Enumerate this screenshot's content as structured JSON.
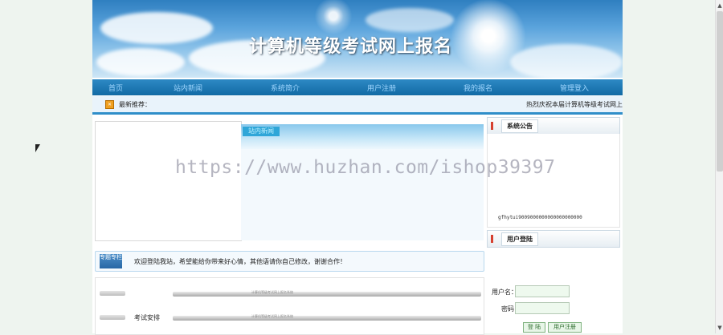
{
  "banner": {
    "title": "计算机等级考试网上报名"
  },
  "nav": {
    "items": [
      {
        "label": "首页"
      },
      {
        "label": "站内新闻"
      },
      {
        "label": "系统简介"
      },
      {
        "label": "用户注册"
      },
      {
        "label": "我的报名"
      },
      {
        "label": "管理登入"
      }
    ]
  },
  "ticker": {
    "label": "最新推荐：",
    "text": "热烈庆祝本届计算机等级考试网上报名系统上线"
  },
  "news": {
    "tab_label": "站内新闻"
  },
  "notice": {
    "title": "系统公告",
    "text": "gfhytui9009000000000000000000"
  },
  "login_box": {
    "title": "用户登陆"
  },
  "welcome": {
    "icon_text": "专题专栏",
    "text": "欢迎登陆我站，希望能给你带来好心情，其他语请你自己修改，谢谢合作！"
  },
  "lower_list": {
    "rows": [
      {
        "label": "",
        "bar_text": "计算机等级考试网上报名系统"
      },
      {
        "label": "考试安排",
        "bar_text": "计算机等级考试网上报名系统"
      }
    ]
  },
  "login": {
    "username_label": "用户名：",
    "password_label": "密码：",
    "login_button": "登 陆",
    "register_button": "用户注册"
  },
  "watermark": "https://www.huzhan.com/ishop39397",
  "colors": {
    "nav_bg": "#1f7db8",
    "accent_red": "#d6402f",
    "page_bg": "#eef4ef"
  }
}
